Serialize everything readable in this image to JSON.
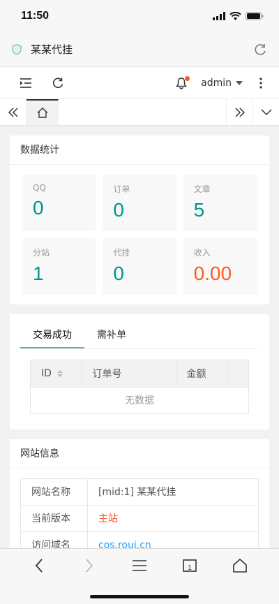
{
  "status": {
    "time": "11:50"
  },
  "browser": {
    "title": "某某代挂"
  },
  "header": {
    "user": "admin"
  },
  "stats": {
    "title": "数据统计",
    "items": [
      {
        "label": "QQ",
        "value": "0"
      },
      {
        "label": "订单",
        "value": "0"
      },
      {
        "label": "文章",
        "value": "5"
      },
      {
        "label": "分站",
        "value": "1"
      },
      {
        "label": "代挂",
        "value": "0"
      },
      {
        "label": "收入",
        "value": "0.00"
      }
    ]
  },
  "orders": {
    "tabs": [
      "交易成功",
      "需补单"
    ],
    "columns": [
      "ID",
      "订单号",
      "金额"
    ],
    "empty_text": "无数据"
  },
  "site": {
    "title": "网站信息",
    "rows": [
      {
        "key": "网站名称",
        "value": "[mid:1] 某某代挂"
      },
      {
        "key": "当前版本",
        "value": "主站"
      },
      {
        "key": "访问域名",
        "value": "cos.roui.cn"
      }
    ]
  },
  "colors": {
    "accent": "#009688",
    "income": "#ff5722",
    "tab_active": "#5fb878",
    "link": "#1e9fff"
  }
}
